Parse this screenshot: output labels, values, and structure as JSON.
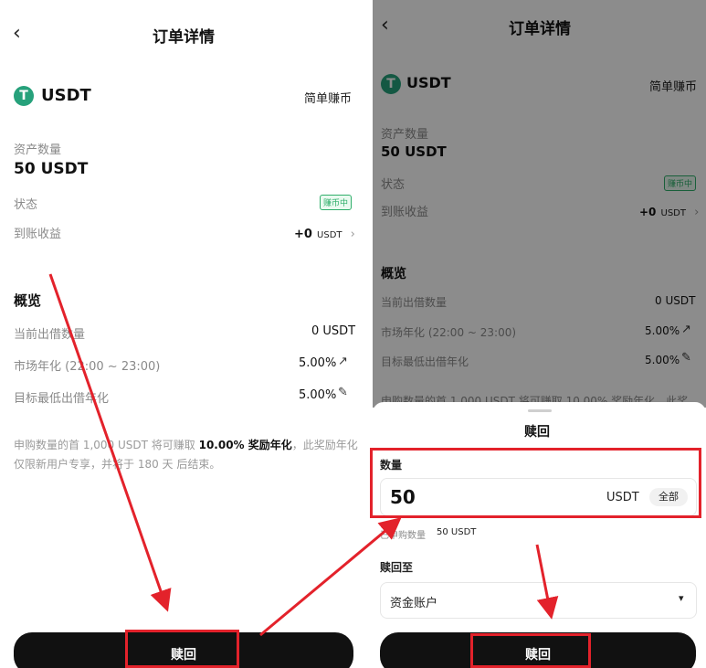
{
  "left": {
    "title": "订单详情",
    "back": "‹",
    "coin": "USDT",
    "coin_logo": "T",
    "product": "简单赚币",
    "asset_label": "资产数量",
    "asset_value": "50 USDT",
    "status_label": "状态",
    "status_badge": "赚币中",
    "earnings_label": "到账收益",
    "earnings_value": "+0",
    "earnings_unit": "USDT",
    "chevron": "›",
    "overview_title": "概览",
    "rows": [
      {
        "label": "当前出借数量",
        "value": "0 USDT"
      },
      {
        "label": "市场年化 (22:00 ~ 23:00)",
        "value": "5.00%"
      },
      {
        "label": "目标最低出借年化",
        "value": "5.00%"
      }
    ],
    "note_part1": "申购数量的首 1,000 USDT 将可赚取 ",
    "note_bold": "10.00% 奖励年化",
    "note_part2": "，此奖励年化仅限新用户专享，并将于 180 天 后结束。",
    "redeem_button": "赎回"
  },
  "right": {
    "title": "订单详情",
    "back": "‹",
    "coin": "USDT",
    "coin_logo": "T",
    "product": "简单赚币",
    "asset_label": "资产数量",
    "asset_value": "50 USDT",
    "status_label": "状态",
    "status_badge": "赚币中",
    "earnings_label": "到账收益",
    "earnings_value": "+0",
    "earnings_unit": "USDT",
    "chevron": "›",
    "overview_title": "概览",
    "rows": [
      {
        "label": "当前出借数量",
        "value": "0 USDT"
      },
      {
        "label": "市场年化 (22:00 ~ 23:00)",
        "value": "5.00%"
      },
      {
        "label": "目标最低出借年化",
        "value": "5.00%"
      }
    ],
    "hidden_note": "申购数量的首 1,000 USDT 将可赚取 10.00% 奖励年化，此奖"
  },
  "sheet": {
    "title": "赎回",
    "amount_label": "数量",
    "amount_value": "50",
    "amount_unit": "USDT",
    "all_button": "全部",
    "purchased_label": "已申购数量",
    "purchased_value": "50 USDT",
    "redeem_to_label": "赎回至",
    "account_value": "资金账户",
    "dropdown_caret": "▾",
    "redeem_button": "赎回"
  },
  "icons": {
    "trend": "↗",
    "edit": "✎"
  },
  "colors": {
    "usdt_green": "#26a17b",
    "badge_green": "#2fae6a",
    "annotation_red": "#e3222b",
    "button_black": "#111111"
  }
}
